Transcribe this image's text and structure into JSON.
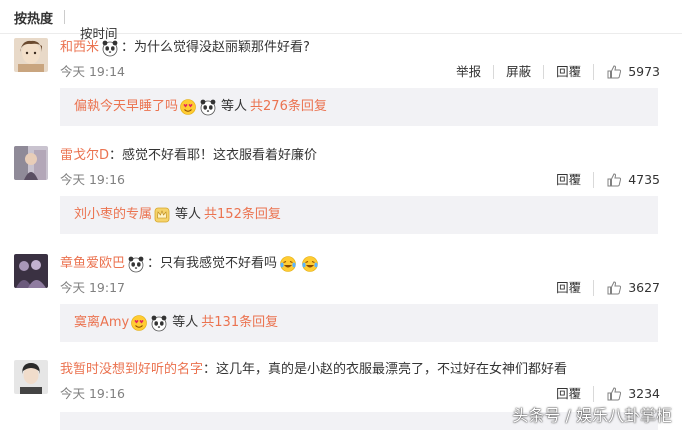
{
  "sort": {
    "hot_label": "按热度",
    "time_label": "按时间"
  },
  "comments": [
    {
      "username": "和西米",
      "text": "：为什么觉得没赵丽颖那件好看?",
      "time": "今天 19:14",
      "actions": [
        "举报",
        "屏蔽",
        "回覆"
      ],
      "likes": "5973",
      "reply": {
        "user": "偏執今天早睡了吗",
        "deng": "等人",
        "count_label": "共276条回复"
      }
    },
    {
      "username": "雷戈尔D",
      "text": "：感觉不好看耶！这衣服看着好廉价",
      "time": "今天 19:16",
      "actions": [
        "回覆"
      ],
      "likes": "4735",
      "reply": {
        "user": "刘小枣的专属",
        "deng": "等人",
        "count_label": "共152条回复"
      }
    },
    {
      "username": "章鱼爱欧巴",
      "text": "：只有我感觉不好看吗",
      "time": "今天 19:17",
      "actions": [
        "回覆"
      ],
      "likes": "3627",
      "reply": {
        "user": "寞离Amy",
        "deng": "等人",
        "count_label": "共131条回复"
      }
    },
    {
      "username": "我暂时没想到好听的名字",
      "text": "：这几年，真的是小赵的衣服最漂亮了，不过好在女神们都好看",
      "time": "今天 19:16",
      "actions": [
        "回覆"
      ],
      "likes": "3234",
      "reply": {
        "user": "",
        "deng": "",
        "count_label": ""
      }
    }
  ],
  "watermark": "头条号 / 娱乐八卦掌柜",
  "colors": {
    "link": "#eb7350",
    "reply_bg": "#f2f2f5",
    "time": "#808080"
  }
}
